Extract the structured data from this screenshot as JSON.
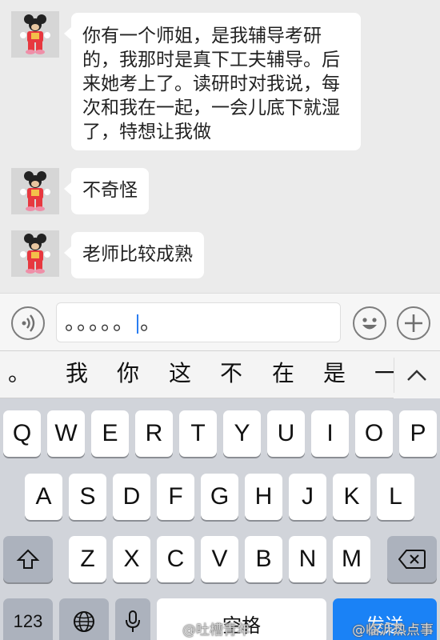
{
  "messages": [
    {
      "lines": [
        "你有一个师姐，是我辅导考研",
        "的，我那时是真下工夫辅导。后",
        "来她考上了。读研时对我说，每",
        "次和我在一起，一会儿底下就湿",
        "了，特想让我做"
      ]
    },
    {
      "lines": [
        "不奇怪"
      ]
    },
    {
      "lines": [
        "老师比较成熟"
      ]
    }
  ],
  "avatar": {
    "icon": "mickey-mouse-avatar"
  },
  "input": {
    "value": "。。。。。",
    "value_tail": "。",
    "voice_icon": "voice-icon",
    "emoji_icon": "emoji-icon",
    "plus_icon": "plus-icon"
  },
  "candidates": {
    "items": [
      "。",
      "我",
      "你",
      "这",
      "不",
      "在",
      "是",
      "一"
    ],
    "toggle_icon": "chevron-up-icon"
  },
  "keyboard": {
    "row1": [
      "Q",
      "W",
      "E",
      "R",
      "T",
      "Y",
      "U",
      "I",
      "O",
      "P"
    ],
    "row2": [
      "A",
      "S",
      "D",
      "F",
      "G",
      "H",
      "J",
      "K",
      "L"
    ],
    "row3": [
      "Z",
      "X",
      "C",
      "V",
      "B",
      "N",
      "M"
    ],
    "shift_icon": "shift-icon",
    "delete_icon": "backspace-icon",
    "numbers_label": "123",
    "globe_icon": "globe-icon",
    "mic_icon": "microphone-icon",
    "space_label": "空格",
    "send_label": "发送"
  },
  "watermarks": {
    "left": "@吐槽青年",
    "right": "@临沂热点事"
  },
  "colors": {
    "chat_bg": "#ebebeb",
    "bubble": "#ffffff",
    "keyboard_bg": "#d1d4da",
    "send_key": "#1a82f6",
    "cursor": "#2a7df1"
  }
}
